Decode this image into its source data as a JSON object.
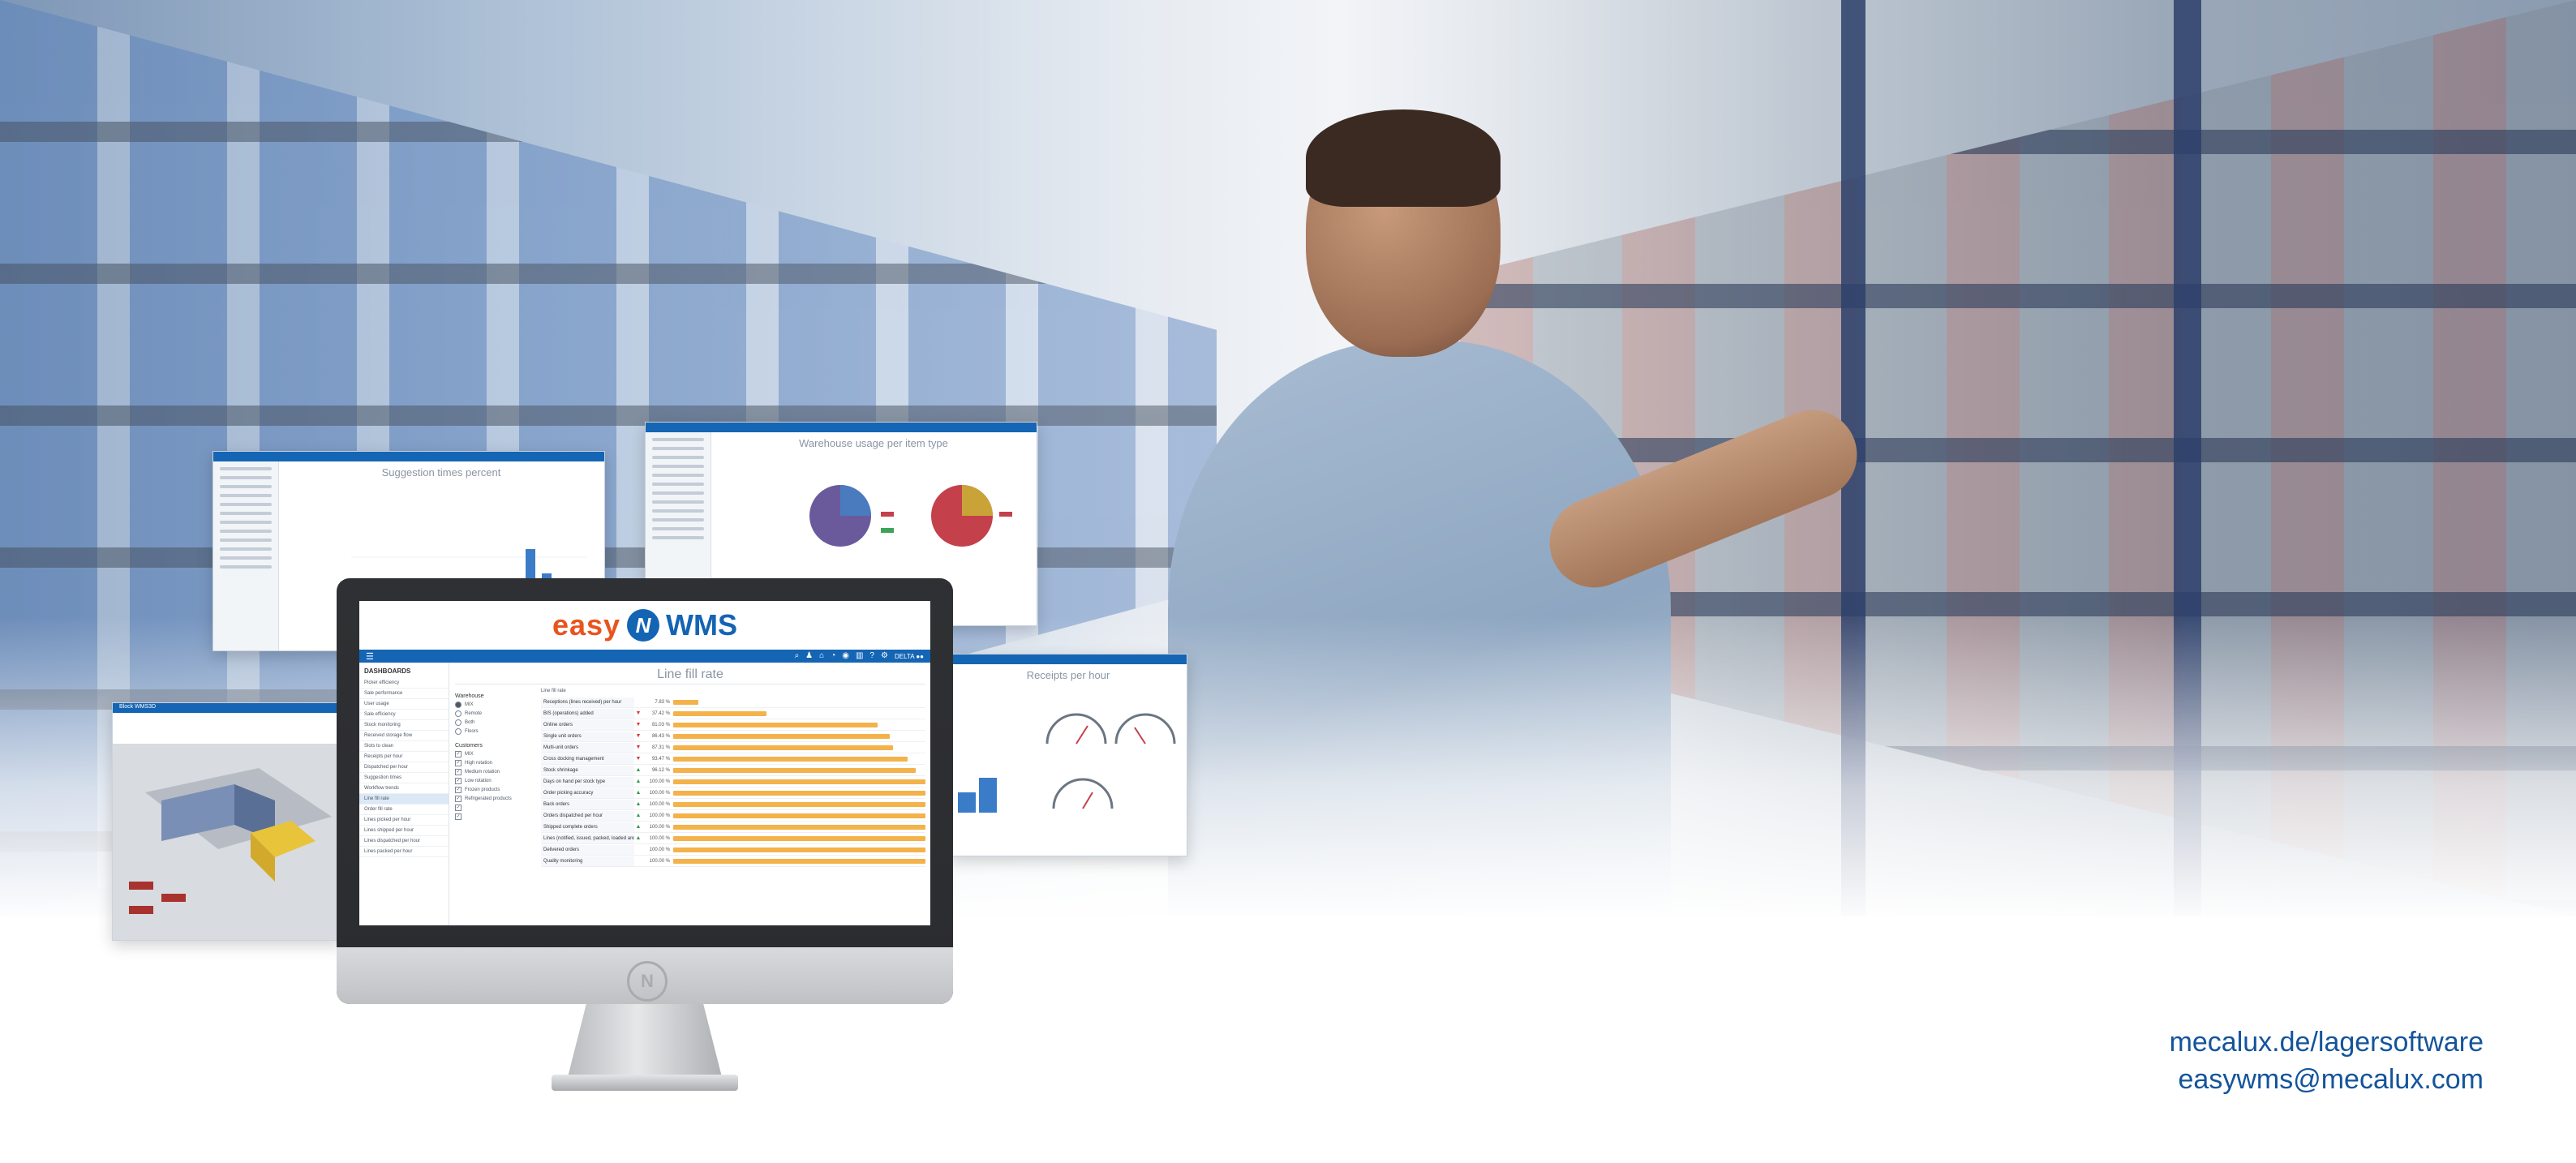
{
  "brand": {
    "easy": "easy",
    "circle": "N",
    "wms": "WMS"
  },
  "monitor": {
    "user_label": "DELTA ●●",
    "sidebar_header": "DASHBOARDS",
    "sidebar_items": [
      "Picker efficiency",
      "Sale performance",
      "User usage",
      "Sale efficiency",
      "Stock monitoring",
      "Received storage flow",
      "Slots to clean",
      "Receipts per hour",
      "Dispatched per hour",
      "Suggestion times",
      "Workflow trends",
      "Line fill rate",
      "Order fill rate",
      "Lines picked per hour",
      "Lines shipped per hour",
      "Lines dispatched per hour",
      "Lines packed per hour"
    ],
    "active_item_index": 11,
    "title": "Line fill rate",
    "warehouse_label": "Warehouse",
    "warehouse_options": [
      "MIX",
      "Remote",
      "Both",
      "Floors"
    ],
    "customers_label": "Customers",
    "customer_options": [
      "MIX",
      "High rotation",
      "Medium rotation",
      "Low rotation",
      "Frozen products",
      "Refrigerated products",
      "",
      ""
    ],
    "table_header": "Line fill rate",
    "rows": [
      {
        "label": "Receptions (lines received) per hour",
        "mk": "",
        "val": "7.83 %",
        "pct": 0.1
      },
      {
        "label": "BIS (operations) added",
        "mk": "▼",
        "val": "37.42 %",
        "pct": 0.37
      },
      {
        "label": "Online orders",
        "mk": "▼",
        "val": "81.03 %",
        "pct": 0.81
      },
      {
        "label": "Single unit orders",
        "mk": "▼",
        "val": "86.43 %",
        "pct": 0.86
      },
      {
        "label": "Multi-unit orders",
        "mk": "▼",
        "val": "87.31 %",
        "pct": 0.87
      },
      {
        "label": "Cross docking management",
        "mk": "▼",
        "val": "93.47 %",
        "pct": 0.93
      },
      {
        "label": "Stock shrinkage",
        "mk": "▲",
        "val": "96.12 %",
        "pct": 0.96
      },
      {
        "label": "Days on hand per stock type",
        "mk": "▲",
        "val": "100.00 %",
        "pct": 1.0
      },
      {
        "label": "Order picking accuracy",
        "mk": "▲",
        "val": "100.00 %",
        "pct": 1.0
      },
      {
        "label": "Back orders",
        "mk": "▲",
        "val": "100.00 %",
        "pct": 1.0
      },
      {
        "label": "Orders dispatched per hour",
        "mk": "▲",
        "val": "100.00 %",
        "pct": 1.0
      },
      {
        "label": "Shipped complete orders",
        "mk": "▲",
        "val": "100.00 %",
        "pct": 1.0
      },
      {
        "label": "Lines (notified, issued, packed, loaded and stored) per hour",
        "mk": "▲",
        "val": "100.00 %",
        "pct": 1.0
      },
      {
        "label": "Delivered orders",
        "mk": "",
        "val": "100.00 %",
        "pct": 1.0
      },
      {
        "label": "Quality monitoring",
        "mk": "",
        "val": "100.00 %",
        "pct": 1.0
      }
    ]
  },
  "windows": {
    "bar_chart_title": "Suggestion times percent",
    "pie_chart_title": "Warehouse usage per item type",
    "gauge_title": "Receipts per hour",
    "layout_title": "Block WMS3D"
  },
  "contact": {
    "website": "mecalux.de/lagersoftware",
    "email": "easywms@mecalux.com"
  },
  "colors": {
    "brand_blue": "#1464b4",
    "brand_orange": "#e8541e",
    "bar_orange": "#f3b24a",
    "contact_blue": "#14549b"
  }
}
